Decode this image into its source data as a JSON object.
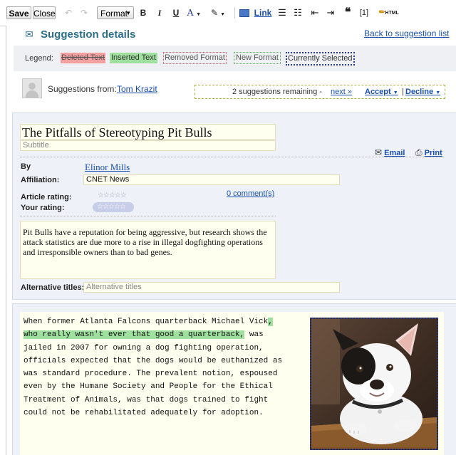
{
  "toolbar": {
    "save": "Save",
    "close": "Close",
    "format": "Format",
    "bold": "B",
    "italic": "I",
    "underline": "U",
    "font_color": "A",
    "link": "Link",
    "footnote": "[1]",
    "html": "HTML"
  },
  "header": {
    "title": "Suggestion details",
    "back_link": "Back to suggestion list"
  },
  "legend": {
    "label": "Legend:",
    "deleted": "Deleted Text",
    "inserted": "Inserted Text",
    "removed_format": "Removed Format",
    "new_format": "New Format",
    "currently_selected": "Currently Selected"
  },
  "suggestions": {
    "from_label": "Suggestions from:",
    "author": "Tom Krazit",
    "remaining": "2 suggestions remaining -",
    "next": "next »",
    "accept": "Accept",
    "separator": "|",
    "decline": "Decline"
  },
  "article": {
    "title": "The Pitfalls of Stereotyping Pit Bulls",
    "subtitle_placeholder": "Subtitle",
    "email": "Email",
    "print": "Print",
    "by_label": "By",
    "author": "Elinor Mills",
    "affiliation_label": "Affiliation:",
    "affiliation": "CNET News",
    "article_rating_label": "Article rating:",
    "your_rating_label": "Your rating:",
    "comments": "0 comment(s)",
    "summary": "Pit Bulls have a reputation for being aggressive, but research shows the attack statistics are due more to a rise in illegal dogfighting operations and irresponsible owners than to bad genes.",
    "alt_titles_label": "Alternative titles:",
    "alt_titles_placeholder": "Alternative titles"
  },
  "body": {
    "line1_a": "When former Atlanta Falcons quarterback Michael Vick",
    "line1_b": ",",
    "line2_a": "who really wasn't ever that good a quarterback,",
    "line2_b": " was",
    "line3": "jailed in 2007 for owning a dog fighting operation,",
    "line4": "officials expected that the dogs would be euthanized as",
    "line5": "was standard procedure. The prevalent notion, espoused",
    "line6": "even by the Humane Society and People for the Ethical",
    "line7": "Treatment of Animals, was that dogs trained to fight",
    "line8": "could not be rehabilitated adequately for adoption."
  },
  "colors": {
    "link": "#1a4fb0",
    "accent_teal": "#2c6f8c",
    "deleted_bg": "#f4a0a0",
    "inserted_bg": "#9fe09f",
    "panel_bg": "#eef2f8",
    "field_bg": "#fffff0"
  }
}
